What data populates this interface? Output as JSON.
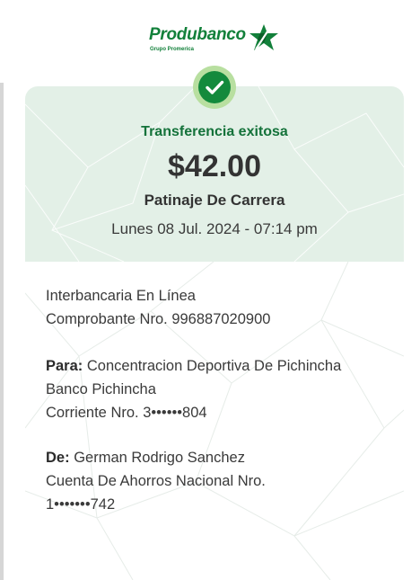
{
  "brand": {
    "name": "Produbanco",
    "subtitle": "Grupo Promerica",
    "color": "#12803a",
    "icon": "star-icon"
  },
  "status": {
    "icon": "check-icon",
    "text": "Transferencia exitosa",
    "color": "#14723a"
  },
  "transfer": {
    "amount": "$42.00",
    "concept": "Patinaje De Carrera",
    "datetime": "Lunes 08 Jul. 2024 - 07:14 pm",
    "type": "Interbancaria En Línea",
    "receipt": "Comprobante Nro. 996887020900"
  },
  "to": {
    "label": "Para:",
    "name": "Concentracion Deportiva De Pichincha",
    "bank": "Banco Pichincha",
    "account": "Corriente Nro. 3••••••804"
  },
  "from": {
    "label": "De:",
    "name": "German Rodrigo Sanchez",
    "account_type": "Cuenta De Ahorros Nacional Nro.",
    "account": "1•••••••742"
  }
}
